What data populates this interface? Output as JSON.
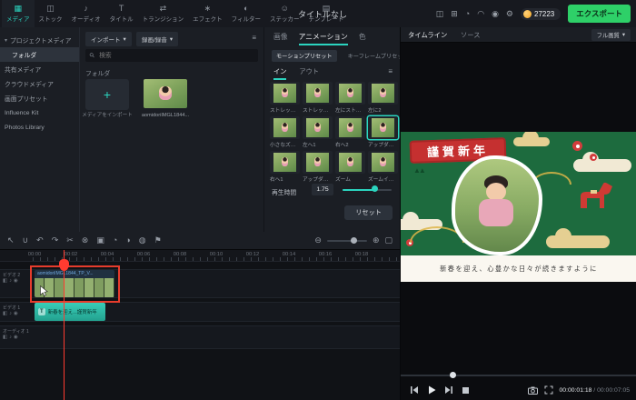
{
  "topbar": {
    "title": "タイトルなし",
    "tools": [
      {
        "label": "メディア",
        "glyph": "▦"
      },
      {
        "label": "ストック",
        "glyph": "◫"
      },
      {
        "label": "オーディオ",
        "glyph": "♪"
      },
      {
        "label": "タイトル",
        "glyph": "T"
      },
      {
        "label": "トランジション",
        "glyph": "⇄"
      },
      {
        "label": "エフェクト",
        "glyph": "∗"
      },
      {
        "label": "フィルター",
        "glyph": "◐"
      },
      {
        "label": "ステッカー",
        "glyph": "☺"
      },
      {
        "label": "テンプレート",
        "glyph": "▤"
      }
    ],
    "right_icons": [
      {
        "name": "layout",
        "glyph": "◫"
      },
      {
        "name": "plugins",
        "glyph": "⊞"
      },
      {
        "name": "notifications",
        "glyph": "◔"
      },
      {
        "name": "cloud-sync",
        "glyph": "◠"
      },
      {
        "name": "account",
        "glyph": "◉"
      },
      {
        "name": "settings",
        "glyph": "⚙"
      }
    ],
    "coin_count": "27223",
    "export_label": "エクスポート"
  },
  "media": {
    "sidebar": [
      {
        "label": "プロジェクトメディア"
      },
      {
        "label": "フォルダ"
      },
      {
        "label": "共有メディア"
      },
      {
        "label": "クラウドメディア"
      },
      {
        "label": "画面プリセット"
      },
      {
        "label": "Influence Kit"
      },
      {
        "label": "Photos Library"
      }
    ],
    "import_label": "インポート",
    "record_label": "録画/録音",
    "search_placeholder": "検索",
    "folder_section": "フォルダ",
    "import_tile_label": "メディアをインポート",
    "clip_name": "aomidoriIMGL1844..."
  },
  "props": {
    "tabs": [
      "画像",
      "アニメーション",
      "色"
    ],
    "preset_tabs": [
      "モーションプリセット",
      "キーフレームプリセット"
    ],
    "direction_tabs": [
      "イン",
      "アウト"
    ],
    "presets": [
      "ストレッチ…",
      "ストレッチ…",
      "左にストレ…",
      "左に2",
      "小さなズ…",
      "左へ1",
      "右へ2",
      "アップダ…",
      "右へ1",
      "アップダ…",
      "ズーム",
      "ズームイ…"
    ],
    "duration_label": "再生時間",
    "duration_value": "1.75",
    "reset_label": "リセット"
  },
  "preview": {
    "tabs": [
      "タイムライン",
      "ソース"
    ],
    "quality": "フル画質",
    "card": {
      "greeting": "謹賀新年",
      "message": "新春を迎え、心豊かな日々が続きますように",
      "pine_glyph": "▲▲"
    },
    "time_current": "00:00:01:18",
    "time_separator": " / ",
    "time_total": "00:00:07:05"
  },
  "timeline": {
    "ruler": [
      "00:00",
      "00:02",
      "00:04",
      "00:06",
      "00:08",
      "00:10",
      "00:12",
      "00:14",
      "00:16",
      "00:18"
    ],
    "tracks": [
      {
        "name": "ビデオ 2"
      },
      {
        "name": "ビデオ 1"
      },
      {
        "name": "オーディオ 1"
      }
    ],
    "clip1_name": "aomidoriIMGL1844_TP_V...",
    "clip2_badge": "T",
    "clip2_name": "新春を迎え...謹賀新年"
  },
  "icons": {
    "chevron_down": "▾",
    "search": "⚲",
    "plus": "+",
    "filter": "≡",
    "pointer": "↖",
    "magnet": "∪",
    "undo": "↶",
    "redo": "↷",
    "split": "✂",
    "delete": "⊗",
    "crop": "▣",
    "speed": "◔",
    "color": "◑",
    "mask": "◍",
    "marker": "⚑",
    "zoom_out": "⊖",
    "zoom_in": "⊕",
    "fit": "▢",
    "lock": "◧",
    "visibility": "◉",
    "mute": "♪"
  }
}
